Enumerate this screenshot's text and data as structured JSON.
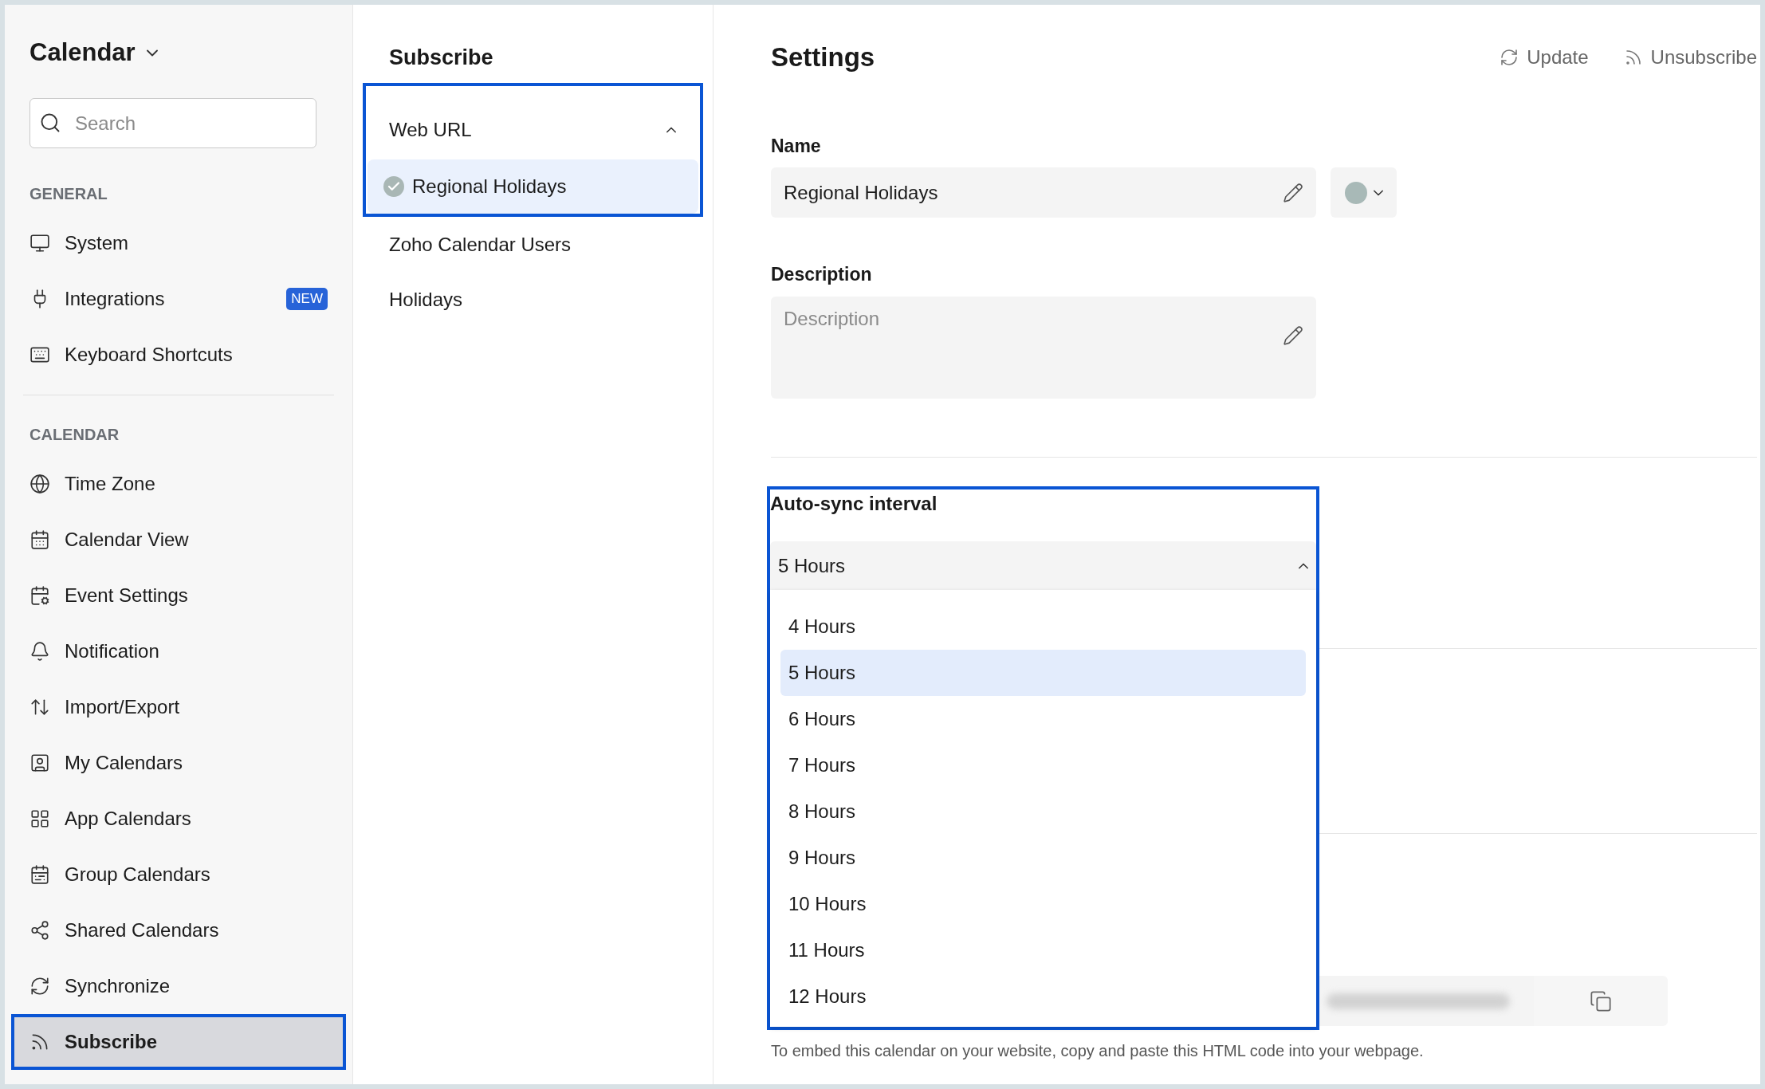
{
  "sidebar": {
    "title": "Calendar",
    "search": {
      "placeholder": "Search"
    },
    "sections": [
      {
        "heading": "GENERAL",
        "items": [
          {
            "label": "System",
            "selected": false
          },
          {
            "label": "Integrations",
            "badge": "NEW",
            "selected": false
          },
          {
            "label": "Keyboard Shortcuts",
            "selected": false
          }
        ]
      },
      {
        "heading": "CALENDAR",
        "items": [
          {
            "label": "Time Zone",
            "selected": false
          },
          {
            "label": "Calendar View",
            "selected": false
          },
          {
            "label": "Event Settings",
            "selected": false
          },
          {
            "label": "Notification",
            "selected": false
          },
          {
            "label": "Import/Export",
            "selected": false
          },
          {
            "label": "My Calendars",
            "selected": false
          },
          {
            "label": "App Calendars",
            "selected": false
          },
          {
            "label": "Group Calendars",
            "selected": false
          },
          {
            "label": "Shared Calendars",
            "selected": false
          },
          {
            "label": "Synchronize",
            "selected": false
          },
          {
            "label": "Subscribe",
            "selected": true
          }
        ]
      }
    ]
  },
  "subscriptions": {
    "title": "Subscribe",
    "groups": [
      {
        "label": "Web URL",
        "expanded": true,
        "children": [
          {
            "label": "Regional Holidays",
            "selected": true
          }
        ]
      },
      {
        "label": "Zoho Calendar Users",
        "expanded": false
      },
      {
        "label": "Holidays",
        "expanded": false
      }
    ]
  },
  "settings": {
    "title": "Settings",
    "actions": [
      "Update",
      "Unsubscribe"
    ],
    "name": {
      "label": "Name",
      "value": "Regional Holidays"
    },
    "description": {
      "label": "Description",
      "placeholder": "Description"
    },
    "auto_sync": {
      "label": "Auto-sync interval",
      "value": "5 Hours",
      "expanded": true,
      "options": [
        {
          "label": "4 Hours",
          "selected": false
        },
        {
          "label": "5 Hours",
          "selected": true
        },
        {
          "label": "6 Hours",
          "selected": false
        },
        {
          "label": "7 Hours",
          "selected": false
        },
        {
          "label": "8 Hours",
          "selected": false
        },
        {
          "label": "9 Hours",
          "selected": false
        },
        {
          "label": "10 Hours",
          "selected": false
        },
        {
          "label": "11 Hours",
          "selected": false
        },
        {
          "label": "12 Hours",
          "selected": false
        }
      ]
    },
    "embed_note": "To embed this calendar on your website, copy and paste this HTML code into your webpage."
  }
}
